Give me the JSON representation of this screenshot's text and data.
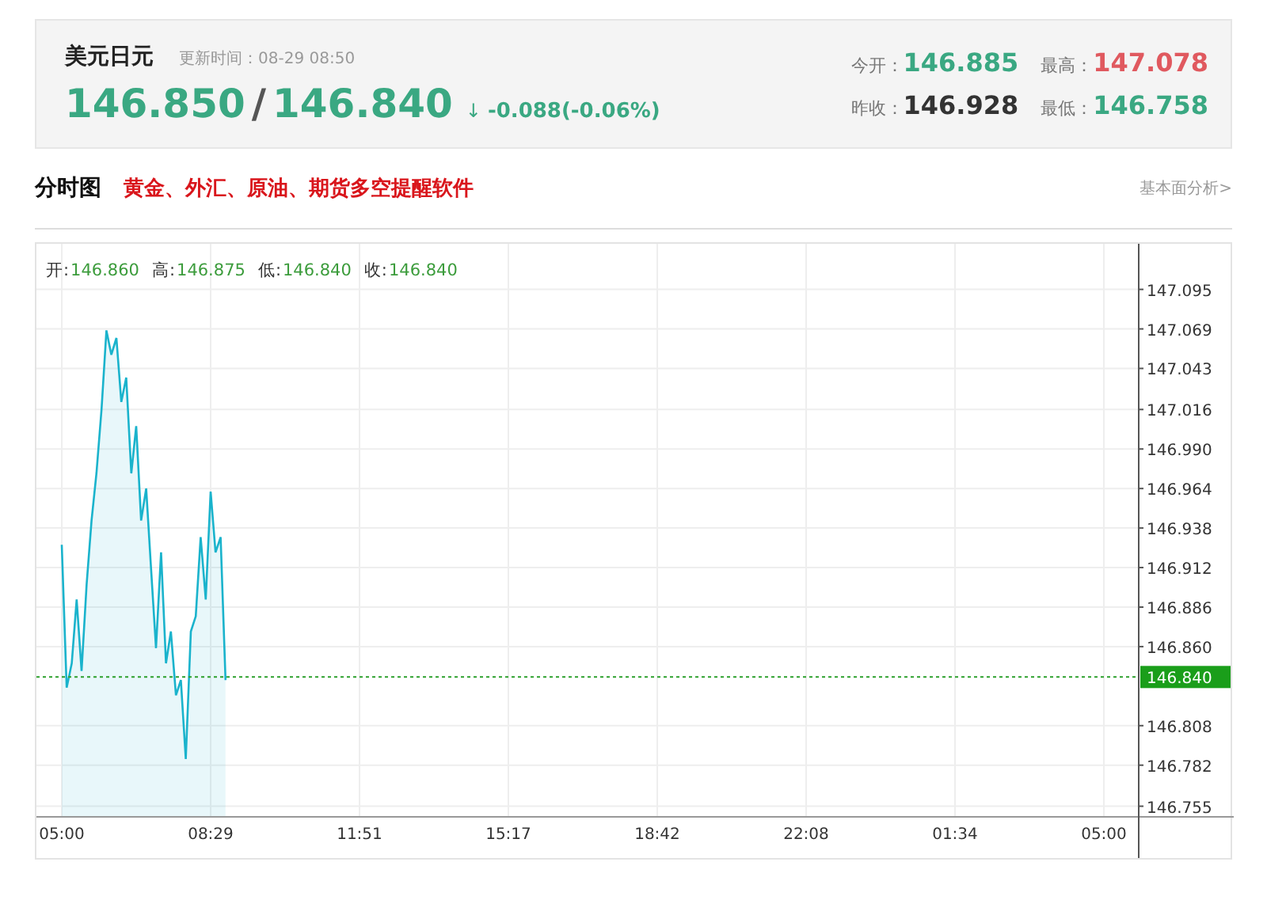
{
  "quote": {
    "name": "美元日元",
    "update_label": "更新时间：",
    "update_time": "08-29 08:50",
    "bid": "146.850",
    "separator": "/",
    "ask": "146.840",
    "arrow": "↓",
    "change": "-0.088(-0.06%)"
  },
  "stats": [
    {
      "label": "今开：",
      "value": "146.885",
      "color": "#3aa882"
    },
    {
      "label": "最高：",
      "value": "147.078",
      "color": "#e0595f"
    },
    {
      "label": "昨收：",
      "value": "146.928",
      "color": "#333333"
    },
    {
      "label": "最低：",
      "value": "146.758",
      "color": "#3aa882"
    }
  ],
  "section": {
    "title": "分时图",
    "promo_link": "黄金、外汇、原油、期货多空提醒软件",
    "more_link": "基本面分析>"
  },
  "ohlc": [
    {
      "label": "开:",
      "value": "146.860"
    },
    {
      "label": "高:",
      "value": "146.875"
    },
    {
      "label": "低:",
      "value": "146.840"
    },
    {
      "label": "收:",
      "value": "146.840"
    }
  ],
  "chart_data": {
    "type": "area",
    "grid": true,
    "ylim": [
      146.748,
      147.125
    ],
    "yticks": [
      {
        "value": 147.095,
        "label": "147.095"
      },
      {
        "value": 147.069,
        "label": "147.069"
      },
      {
        "value": 147.043,
        "label": "147.043"
      },
      {
        "value": 147.016,
        "label": "147.016"
      },
      {
        "value": 146.99,
        "label": "146.990"
      },
      {
        "value": 146.964,
        "label": "146.964"
      },
      {
        "value": 146.938,
        "label": "146.938"
      },
      {
        "value": 146.912,
        "label": "146.912"
      },
      {
        "value": 146.886,
        "label": "146.886"
      },
      {
        "value": 146.86,
        "label": "146.860"
      },
      {
        "value": 146.808,
        "label": "146.808"
      },
      {
        "value": 146.782,
        "label": "146.782"
      },
      {
        "value": 146.755,
        "label": "146.755"
      }
    ],
    "categories": [
      "05:00",
      null,
      null,
      null,
      null,
      null,
      null,
      null,
      null,
      null,
      null,
      null,
      null,
      null,
      null,
      null,
      null,
      null,
      null,
      null,
      null,
      null,
      null,
      null,
      null,
      null,
      null,
      null,
      null,
      null,
      "08:29",
      null,
      null,
      null,
      null,
      null,
      null,
      null,
      null,
      null,
      null,
      null,
      null,
      null,
      null,
      null,
      null,
      null,
      null,
      null,
      null,
      null,
      null,
      null,
      null,
      null,
      null,
      null,
      null,
      null,
      "11:51",
      null,
      null,
      null,
      null,
      null,
      null,
      null,
      null,
      null,
      null,
      null,
      null,
      null,
      null,
      null,
      null,
      null,
      null,
      null,
      null,
      null,
      null,
      null,
      null,
      null,
      null,
      null,
      null,
      null,
      "15:17",
      null,
      null,
      null,
      null,
      null,
      null,
      null,
      null,
      null,
      null,
      null,
      null,
      null,
      null,
      null,
      null,
      null,
      null,
      null,
      null,
      null,
      null,
      null,
      null,
      null,
      null,
      null,
      null,
      null,
      "18:42",
      null,
      null,
      null,
      null,
      null,
      null,
      null,
      null,
      null,
      null,
      null,
      null,
      null,
      null,
      null,
      null,
      null,
      null,
      null,
      null,
      null,
      null,
      null,
      null,
      null,
      null,
      null,
      null,
      null,
      "22:08",
      null,
      null,
      null,
      null,
      null,
      null,
      null,
      null,
      null,
      null,
      null,
      null,
      null,
      null,
      null,
      null,
      null,
      null,
      null,
      null,
      null,
      null,
      null,
      null,
      null,
      null,
      null,
      null,
      null,
      "01:34",
      null,
      null,
      null,
      null,
      null,
      null,
      null,
      null,
      null,
      null,
      null,
      null,
      null,
      null,
      null,
      null,
      null,
      null,
      null,
      null,
      null,
      null,
      null,
      null,
      null,
      null,
      null,
      null,
      null,
      "05:00"
    ],
    "series": [
      {
        "color": "#1ab3cc",
        "values": [
          146.927,
          146.833,
          146.849,
          146.891,
          146.844,
          146.901,
          146.943,
          146.974,
          147.016,
          147.068,
          147.052,
          147.063,
          147.021,
          147.037,
          146.974,
          147.005,
          146.943,
          146.964,
          146.911,
          146.859,
          146.922,
          146.849,
          146.87,
          146.828,
          146.838,
          146.786,
          146.87,
          146.88,
          146.932,
          146.891,
          146.962,
          146.922,
          146.932,
          146.838,
          null,
          null,
          null,
          null,
          null,
          null,
          null,
          null,
          null,
          null,
          null,
          null,
          null,
          null,
          null,
          null,
          null,
          null,
          null,
          null,
          null,
          null,
          null,
          null,
          null,
          null,
          null,
          null,
          null,
          null,
          null,
          null,
          null,
          null,
          null,
          null,
          null,
          null,
          null,
          null,
          null,
          null,
          null,
          null,
          null,
          null,
          null,
          null,
          null,
          null,
          null,
          null,
          null,
          null,
          null,
          null,
          null,
          null,
          null,
          null,
          null,
          null,
          null,
          null,
          null,
          null,
          null,
          null,
          null,
          null,
          null,
          null,
          null,
          null,
          null,
          null,
          null,
          null,
          null,
          null,
          null,
          null,
          null,
          null,
          null,
          null,
          null,
          null,
          null,
          null,
          null,
          null,
          null,
          null,
          null,
          null,
          null,
          null,
          null,
          null,
          null,
          null,
          null,
          null,
          null,
          null,
          null,
          null,
          null,
          null,
          null,
          null,
          null,
          null,
          null,
          null,
          null,
          null,
          null,
          null,
          null,
          null,
          null,
          null,
          null,
          null,
          null,
          null,
          null,
          null,
          null,
          null,
          null,
          null,
          null,
          null,
          null,
          null,
          null,
          null,
          null,
          null,
          null,
          null,
          null,
          null,
          null,
          null,
          null,
          null,
          null,
          null,
          null,
          null,
          null,
          null,
          null,
          null,
          null,
          null,
          null,
          null,
          null,
          null,
          null,
          null,
          null,
          null,
          null,
          null,
          null,
          null,
          null,
          null,
          null,
          null,
          null
        ]
      }
    ],
    "ref_lines": [
      {
        "axis": "y",
        "value": 146.84,
        "label": "146.840"
      }
    ]
  }
}
